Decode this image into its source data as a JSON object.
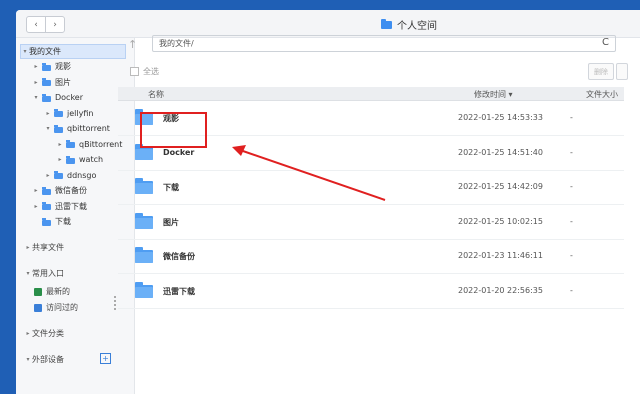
{
  "window": {
    "title": "个人空间"
  },
  "nav": {
    "back": "‹",
    "forward": "›"
  },
  "sidebar": {
    "root": "我的文件",
    "tree": [
      {
        "label": "观影",
        "level": 1,
        "arrow": "▸"
      },
      {
        "label": "图片",
        "level": 1,
        "arrow": "▸"
      },
      {
        "label": "Docker",
        "level": 1,
        "arrow": "▾"
      },
      {
        "label": "jellyfin",
        "level": 2,
        "arrow": "▸"
      },
      {
        "label": "qbittorrent",
        "level": 2,
        "arrow": "▾"
      },
      {
        "label": "qBittorrent",
        "level": 3,
        "arrow": "▸"
      },
      {
        "label": "watch",
        "level": 3,
        "arrow": "▸"
      },
      {
        "label": "ddnsgo",
        "level": 2,
        "arrow": "▸"
      },
      {
        "label": "微信备份",
        "level": 1,
        "arrow": "▸"
      },
      {
        "label": "迅雷下载",
        "level": 1,
        "arrow": "▸"
      },
      {
        "label": "下载",
        "level": 1,
        "arrow": ""
      }
    ],
    "shared": "共享文件",
    "common": "常用入口",
    "latest": "最新的",
    "visited": "访问过的",
    "category": "文件分类",
    "external": "外部设备",
    "plus": "+"
  },
  "toolbar": {
    "path": "我的文件/",
    "select_all": "全选",
    "delete": "删除",
    "refresh_icon": "C"
  },
  "columns": {
    "name": "名称",
    "modified": "修改时间 ▾",
    "size": "文件大小"
  },
  "files": [
    {
      "name": "观影",
      "modified": "2022-01-25 14:53:33",
      "size": "-"
    },
    {
      "name": "Docker",
      "modified": "2022-01-25 14:51:40",
      "size": "-"
    },
    {
      "name": "下载",
      "modified": "2022-01-25 14:42:09",
      "size": "-"
    },
    {
      "name": "图片",
      "modified": "2022-01-25 10:02:15",
      "size": "-"
    },
    {
      "name": "微信备份",
      "modified": "2022-01-23 11:46:11",
      "size": "-"
    },
    {
      "name": "迅雷下载",
      "modified": "2022-01-20 22:56:35",
      "size": "-"
    }
  ],
  "colors": {
    "accent": "#3e8ef0",
    "annotation": "#e02020",
    "desktop": "#1f5fb5"
  }
}
